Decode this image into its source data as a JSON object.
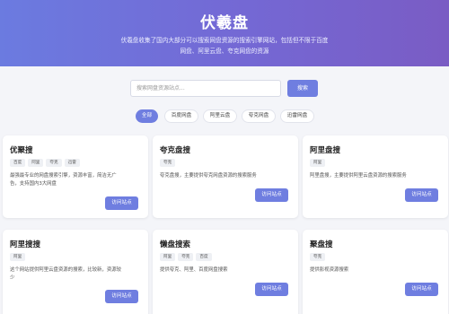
{
  "hero": {
    "title": "伏羲盘",
    "description_line1": "伏羲盘收集了国内大部分可以搜索网盘资源的搜索引擎网站，包括但不限于百度",
    "description_line2": "网盘、阿里云盘、夸克网盘的资源"
  },
  "search": {
    "placeholder": "搜索网盘资源站点...",
    "button_label": "搜索"
  },
  "filters": [
    "全部",
    "百度网盘",
    "阿里云盘",
    "夸克网盘",
    "迅雷网盘"
  ],
  "active_filter": "全部",
  "cards": [
    {
      "title": "优聚搜",
      "tags": [
        "百度",
        "阿里",
        "夸克",
        "迅雷"
      ],
      "desc1": "最强最专业的网盘搜索引擎，资源丰富，简洁无广",
      "desc2": "告，支持国内3大网盘",
      "button": "访问站点"
    },
    {
      "title": "夸克盘搜",
      "tags": [
        "夸克"
      ],
      "desc1": "夸克盘搜，主要提供夸克网盘资源的搜索服务",
      "desc2": "",
      "button": "访问站点"
    },
    {
      "title": "阿里盘搜",
      "tags": [
        "阿里"
      ],
      "desc1": "阿里盘搜，主要提供阿里云盘资源的搜索服务",
      "desc2": "",
      "button": "访问站点"
    },
    {
      "title": "阿里搜搜",
      "tags": [
        "阿里"
      ],
      "desc1": "这个网站提供阿里云盘资源的搜索，比较新，资源较",
      "desc2": "少",
      "button": "访问站点"
    },
    {
      "title": "懒盘搜索",
      "tags": [
        "阿里",
        "夸克",
        "百度"
      ],
      "desc1": "提供夸克、阿里、百度网盘搜索",
      "desc2": "",
      "button": "访问站点"
    },
    {
      "title": "聚盘搜",
      "tags": [
        "夸克"
      ],
      "desc1": "提供影视资源搜索",
      "desc2": "",
      "button": "访问站点"
    }
  ],
  "colors": {
    "accent": "#6f7ee0",
    "hero_gradient_start": "#6b7be0",
    "hero_gradient_end": "#7a5cc4",
    "background": "#f4f5f9"
  }
}
